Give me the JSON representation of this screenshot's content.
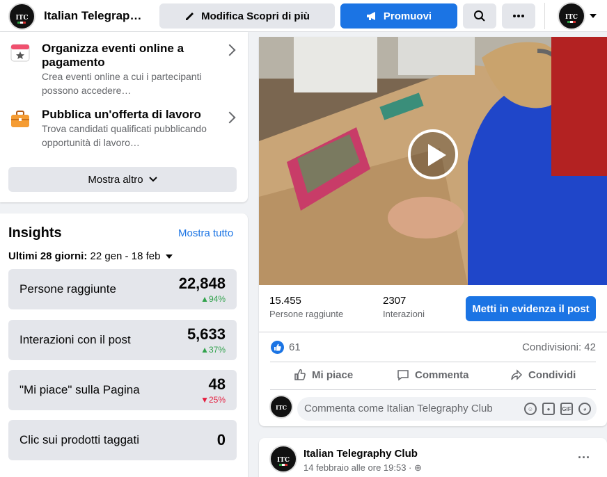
{
  "topbar": {
    "page_name": "Italian Telegraph…",
    "edit_label": "Modifica Scopri di più",
    "promote_label": "Promuovi",
    "search_icon": "search-icon",
    "more_icon": "more-icon"
  },
  "features": [
    {
      "title": "Organizza eventi online a pagamento",
      "desc": "Crea eventi online a cui i partecipanti possono accedere…",
      "icon": "calendar-icon"
    },
    {
      "title": "Pubblica un'offerta di lavoro",
      "desc": "Trova candidati qualificati pubblicando opportunità di lavoro…",
      "icon": "briefcase-icon"
    }
  ],
  "show_more_label": "Mostra altro",
  "insights": {
    "title": "Insights",
    "see_all": "Mostra tutto",
    "period_label": "Ultimi 28 giorni:",
    "period_value": " 22 gen - 18 feb",
    "stats": [
      {
        "label": "Persone raggiunte",
        "value": "22,848",
        "change": "94%",
        "direction": "up"
      },
      {
        "label": "Interazioni con il post",
        "value": "5,633",
        "change": "37%",
        "direction": "up"
      },
      {
        "label": "\"Mi piace\" sulla Pagina",
        "value": "48",
        "change": "25%",
        "direction": "down"
      },
      {
        "label": "Clic sui prodotti taggati",
        "value": "0",
        "change": "",
        "direction": ""
      }
    ]
  },
  "post": {
    "reach_value": "15.455",
    "reach_label": "Persone raggiunte",
    "interactions_value": "2307",
    "interactions_label": "Interazioni",
    "boost_label": "Metti in evidenza il post",
    "likes_count": "61",
    "shares_label": "Condivisioni: 42",
    "like_action": "Mi piace",
    "comment_action": "Commenta",
    "share_action": "Condividi",
    "comment_placeholder": "Commenta come Italian Telegraphy Club",
    "gif_label": "GIF"
  },
  "next_post": {
    "author": "Italian Telegraphy Club",
    "date": "14 febbraio alle ore 19:53 · ",
    "more_label": "···"
  },
  "colors": {
    "accent": "#1b74e4",
    "up": "#31a24c",
    "down": "#e41e3f"
  }
}
